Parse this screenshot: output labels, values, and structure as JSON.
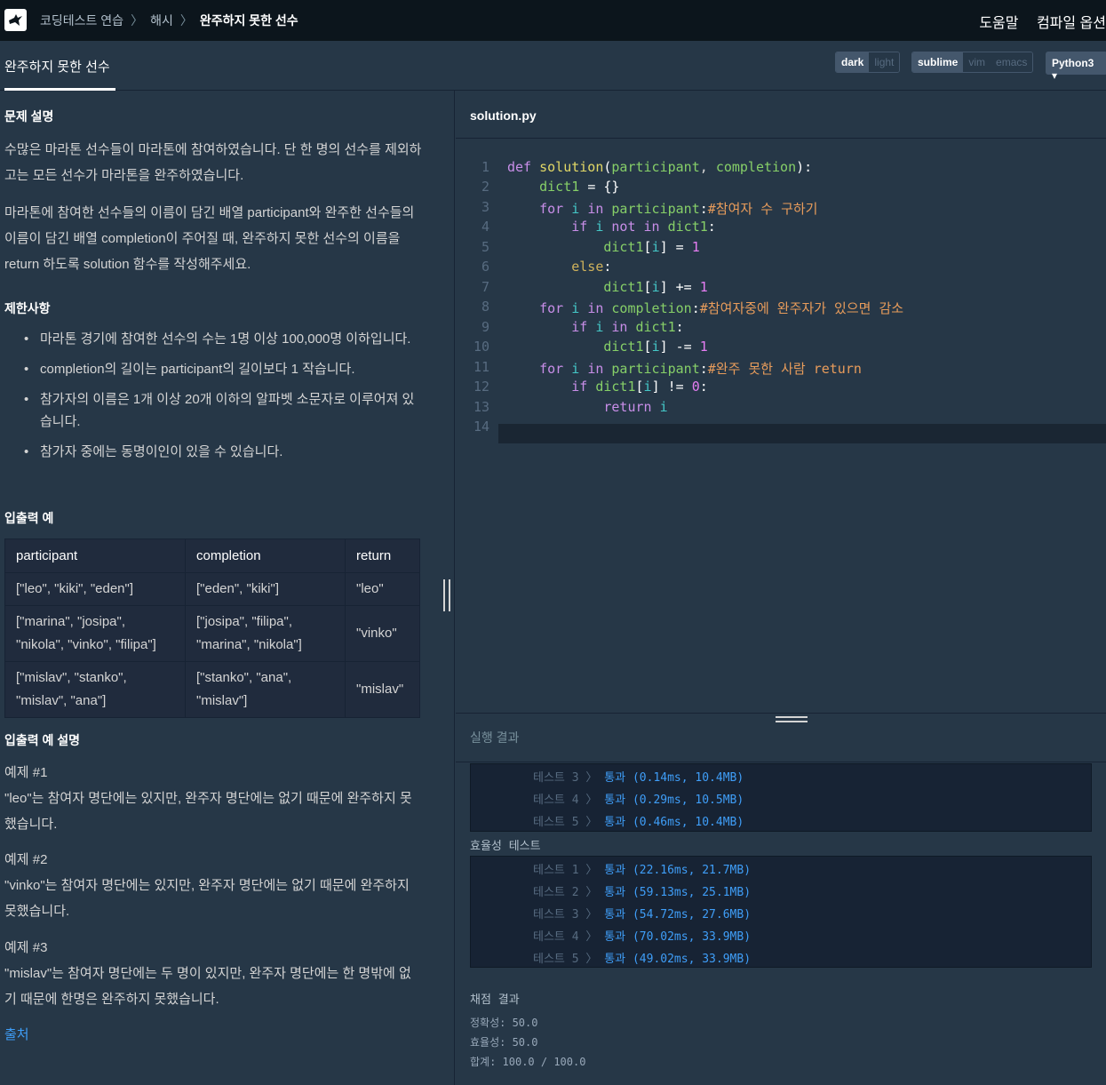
{
  "topbar": {
    "breadcrumb": [
      "코딩테스트 연습",
      "해시",
      "완주하지 못한 선수"
    ],
    "right_links": [
      "도움말",
      "컴파일 옵션"
    ]
  },
  "tab": {
    "title": "완주하지 못한 선수"
  },
  "toolbar": {
    "theme": [
      "dark",
      "light"
    ],
    "keymap": [
      "sublime",
      "vim",
      "emacs"
    ],
    "language": "Python3"
  },
  "problem": {
    "h_desc": "문제 설명",
    "desc1": "수많은 마라톤 선수들이 마라톤에 참여하였습니다. 단 한 명의 선수를 제외하고는 모든 선수가 마라톤을 완주하였습니다.",
    "desc2": "마라톤에 참여한 선수들의 이름이 담긴 배열 participant와 완주한 선수들의 이름이 담긴 배열 completion이 주어질 때, 완주하지 못한 선수의 이름을 return 하도록 solution 함수를 작성해주세요.",
    "h_limits": "제한사항",
    "limits": [
      "마라톤 경기에 참여한 선수의 수는 1명 이상 100,000명 이하입니다.",
      "completion의 길이는 participant의 길이보다 1 작습니다.",
      "참가자의 이름은 1개 이상 20개 이하의 알파벳 소문자로 이루어져 있습니다.",
      "참가자 중에는 동명이인이 있을 수 있습니다."
    ],
    "h_io": "입출력 예",
    "table": {
      "headers": [
        "participant",
        "completion",
        "return"
      ],
      "rows": [
        [
          "[\"leo\", \"kiki\", \"eden\"]",
          "[\"eden\", \"kiki\"]",
          "\"leo\""
        ],
        [
          "[\"marina\", \"josipa\", \"nikola\", \"vinko\", \"filipa\"]",
          "[\"josipa\", \"filipa\", \"marina\", \"nikola\"]",
          "\"vinko\""
        ],
        [
          "[\"mislav\", \"stanko\", \"mislav\", \"ana\"]",
          "[\"stanko\", \"ana\", \"mislav\"]",
          "\"mislav\""
        ]
      ]
    },
    "h_io_desc": "입출력 예 설명",
    "ex1_title": "예제 #1",
    "ex1": "\"leo\"는 참여자 명단에는 있지만, 완주자 명단에는 없기 때문에 완주하지 못했습니다.",
    "ex2_title": "예제 #2",
    "ex2": "\"vinko\"는 참여자 명단에는 있지만, 완주자 명단에는 없기 때문에 완주하지 못했습니다.",
    "ex3_title": "예제 #3",
    "ex3": "\"mislav\"는 참여자 명단에는 두 명이 있지만, 완주자 명단에는 한 명밖에 없기 때문에 한명은 완주하지 못했습니다.",
    "source_link": "출처"
  },
  "editor": {
    "filename": "solution.py",
    "line_numbers": [
      "1",
      "2",
      "3",
      "4",
      "5",
      "6",
      "7",
      "8",
      "9",
      "10",
      "11",
      "12",
      "13",
      "14"
    ]
  },
  "results": {
    "title": "실행 결과",
    "acc_rows": [
      {
        "label": "테스트 3",
        "result": "통과 (0.14ms, 10.4MB)"
      },
      {
        "label": "테스트 4",
        "result": "통과 (0.29ms, 10.5MB)"
      },
      {
        "label": "테스트 5",
        "result": "통과 (0.46ms, 10.4MB)"
      }
    ],
    "eff_title": "효율성  테스트",
    "eff_rows": [
      {
        "label": "테스트 1",
        "result": "통과 (22.16ms, 21.7MB)"
      },
      {
        "label": "테스트 2",
        "result": "통과 (59.13ms, 25.1MB)"
      },
      {
        "label": "테스트 3",
        "result": "통과 (54.72ms, 27.6MB)"
      },
      {
        "label": "테스트 4",
        "result": "통과 (70.02ms, 33.9MB)"
      },
      {
        "label": "테스트 5",
        "result": "통과 (49.02ms, 33.9MB)"
      }
    ],
    "grade_title": "채점 결과",
    "accuracy": "정확성: 50.0",
    "efficiency": "효율성: 50.0",
    "total": "합계: 100.0 / 100.0"
  },
  "colors": {
    "bg": "#263747",
    "topbar": "#0c151c",
    "pass": "#3f9ef8",
    "link": "#3f9ef8"
  }
}
